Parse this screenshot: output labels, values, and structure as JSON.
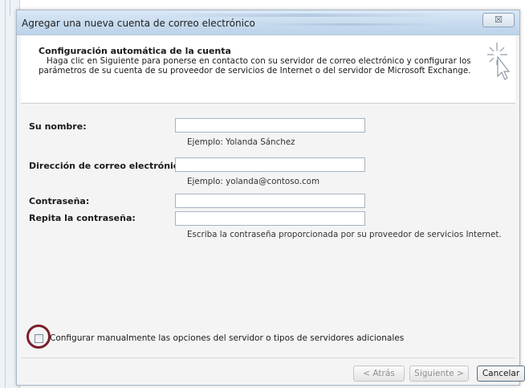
{
  "dialog": {
    "title": "Agregar una nueva cuenta de correo electrónico",
    "close_glyph": "☒"
  },
  "header": {
    "title": "Configuración automática de la cuenta",
    "description": "Haga clic en Siguiente para ponerse en contacto con su servidor de correo electrónico y configurar los parámetros de su cuenta de su proveedor de servicios de Internet o del servidor de Microsoft Exchange.",
    "icon": "wizard-cursor-icon"
  },
  "form": {
    "name_label": "Su nombre:",
    "name_value": "",
    "name_hint": "Ejemplo: Yolanda Sánchez",
    "email_label": "Dirección de correo electrónico:",
    "email_value": "",
    "email_hint": "Ejemplo: yolanda@contoso.com",
    "password_label": "Contraseña:",
    "password_value": "",
    "repeat_label": "Repita la contraseña:",
    "repeat_value": "",
    "password_hint": "Escriba la contraseña proporcionada por su proveedor de servicios Internet.",
    "manual_label": "Configurar manualmente las opciones del servidor o tipos de servidores adicionales",
    "manual_checked": false
  },
  "footer": {
    "back_label": "< Atrás",
    "next_label": "Siguiente >",
    "cancel_label": "Cancelar"
  },
  "colors": {
    "annotation": "#7a1f2b",
    "titlebar": "#c9dcef"
  }
}
